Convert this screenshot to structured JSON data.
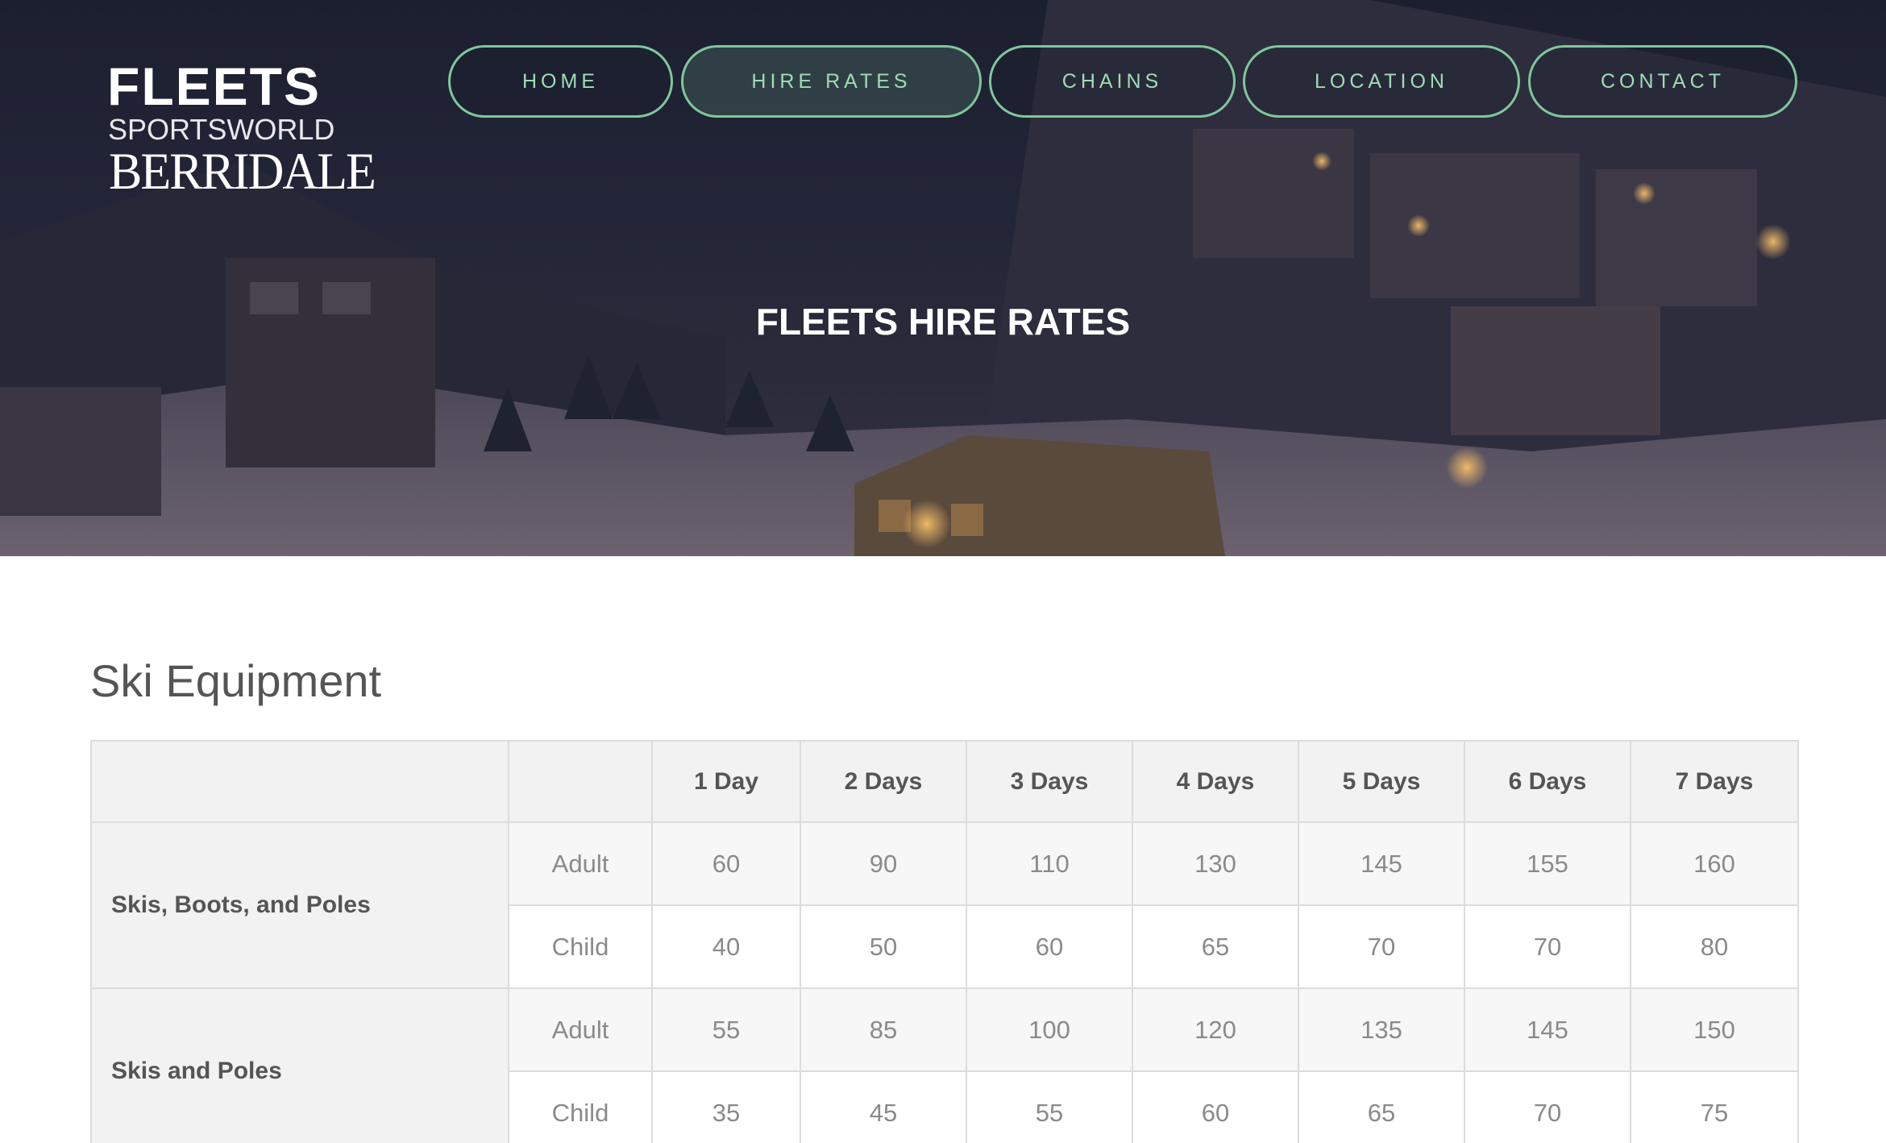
{
  "logo": {
    "line1": "FLEETS",
    "line2": "SPORTSWORLD",
    "line3": "BERRIDALE"
  },
  "nav": {
    "items": [
      {
        "label": "HOME",
        "active": false
      },
      {
        "label": "HIRE RATES",
        "active": true
      },
      {
        "label": "CHAINS",
        "active": false
      },
      {
        "label": "LOCATION",
        "active": false
      },
      {
        "label": "CONTACT",
        "active": false
      }
    ]
  },
  "hero": {
    "title": "FLEETS HIRE RATES"
  },
  "section": {
    "title": "Ski Equipment"
  },
  "table": {
    "headers": [
      "",
      "",
      "1 Day",
      "2 Days",
      "3 Days",
      "4 Days",
      "5 Days",
      "6 Days",
      "7 Days"
    ],
    "groups": [
      {
        "name": "Skis, Boots, and Poles",
        "rows": [
          {
            "type": "Adult",
            "values": [
              "60",
              "90",
              "110",
              "130",
              "145",
              "155",
              "160"
            ]
          },
          {
            "type": "Child",
            "values": [
              "40",
              "50",
              "60",
              "65",
              "70",
              "70",
              "80"
            ]
          }
        ]
      },
      {
        "name": "Skis and Poles",
        "rows": [
          {
            "type": "Adult",
            "values": [
              "55",
              "85",
              "100",
              "120",
              "135",
              "145",
              "150"
            ]
          },
          {
            "type": "Child",
            "values": [
              "35",
              "45",
              "55",
              "60",
              "65",
              "70",
              "75"
            ]
          }
        ]
      }
    ]
  },
  "colors": {
    "nav_border": "#7fc79a",
    "nav_text": "#9fdcb4",
    "hero_bg": "#1c1f30"
  }
}
